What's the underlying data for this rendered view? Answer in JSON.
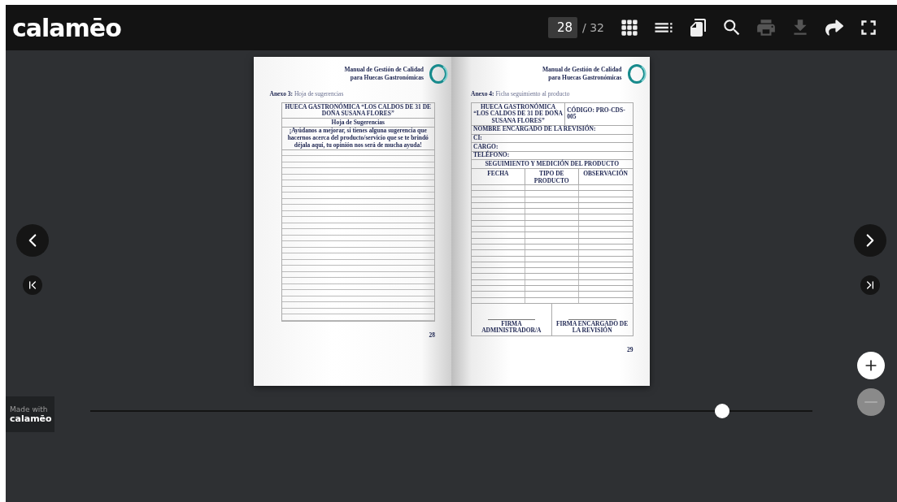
{
  "header": {
    "logo": "calamēo",
    "page_field": {
      "value": "28"
    },
    "page_total": "/ 32",
    "tools": [
      {
        "kind": "grid",
        "disabled": false
      },
      {
        "kind": "list",
        "disabled": false
      },
      {
        "kind": "pages",
        "disabled": false
      },
      {
        "kind": "search",
        "disabled": false
      },
      {
        "kind": "print",
        "disabled": true
      },
      {
        "kind": "download",
        "disabled": true
      },
      {
        "kind": "share",
        "disabled": false
      },
      {
        "kind": "fullscreen",
        "disabled": false
      }
    ]
  },
  "book": {
    "left_page": {
      "header": [
        "Manual de Gestión de Calidad",
        "para Huecas Gastronómicas"
      ],
      "annex": "**Anexo 3:** Hoja de sugerencias",
      "table": {
        "title": "HUECA GASTRONÓMICA “LOS CALDOS DE 31 DE DOÑA SUSANA FLORES”",
        "subtitle": "Hoja de Sugerencias",
        "message": "¡Ayúdanos a mejorar, si tienes alguna sugerencia que hacernos acerca del producto/servicio que se te brindó déjala aquí, tu opinión nos será de mucha ayuda!"
      },
      "page_number": "28"
    },
    "right_page": {
      "header": [
        "Manual de Gestión de Calidad",
        "para Huecas Gastronómicas"
      ],
      "annex": "**Anexo 4:** Ficha seguimiento al producto",
      "table": {
        "title": "HUECA GASTRONÓMICA “LOS CALDOS DE 31 DE DOÑA SUSANA FLORES”",
        "code": "CÓDIGO: PRO-CDS-005",
        "fields": [
          "NOMBRE ENCARGADO DE LA REVISIÓN:",
          "CI:",
          "CARGO:",
          "TELÉFONO:"
        ],
        "section": "SEGUIMIENTO Y MEDICIÓN DEL PRODUCTO",
        "columns": [
          "FECHA",
          "TIPO DE PRODUCTO",
          "OBSERVACIÓN"
        ],
        "signatures": [
          "FIRMA ADMINISTRADOR/A",
          "FIRMA ENCARGADO DE LA REVISIÓN"
        ]
      },
      "page_number": "29"
    }
  },
  "badge": {
    "line_1": "Made with",
    "line_2": "calamēo"
  },
  "zoom_slider": {
    "level": 0.875
  },
  "zoom_buttons": [
    {
      "kind": "plus",
      "disabled": false
    },
    {
      "kind": "minus",
      "disabled": true
    }
  ]
}
